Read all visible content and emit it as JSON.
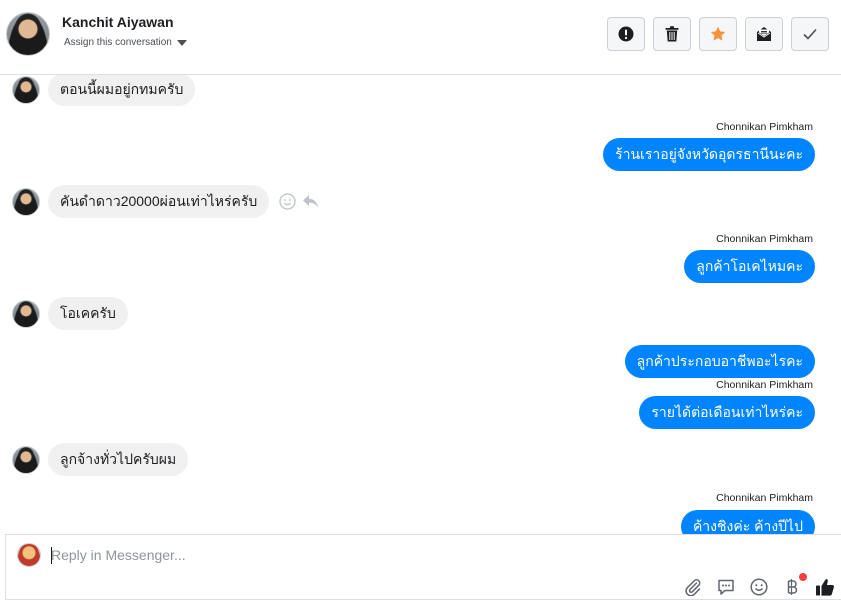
{
  "header": {
    "contact_name": "Kanchit Aiyawan",
    "assign_label": "Assign this conversation",
    "toolbar": [
      {
        "name": "mark-spam-button",
        "icon": "exclamation-circle-icon"
      },
      {
        "name": "delete-button",
        "icon": "trash-icon"
      },
      {
        "name": "star-button",
        "icon": "star-icon",
        "color": "#f7923b"
      },
      {
        "name": "mark-unread-button",
        "icon": "envelope-icon"
      },
      {
        "name": "mark-done-button",
        "icon": "check-icon"
      }
    ]
  },
  "messages": [
    {
      "direction": "in",
      "text": "ตอนนี้ผมอยู่กทมครับ"
    },
    {
      "direction": "out",
      "sender": "Chonnikan Pimkham",
      "text": "ร้านเราอยู่จังหวัดอุดรธานีนะคะ"
    },
    {
      "direction": "in",
      "text": "คันดำดาว20000ผ่อนเท่าไหร่ครับ"
    },
    {
      "direction": "out",
      "sender": "Chonnikan Pimkham",
      "text": "ลูกค้าโอเคไหมคะ"
    },
    {
      "direction": "in",
      "text": "โอเคครับ"
    },
    {
      "direction": "out",
      "text": "ลูกค้าประกอบอาชีพอะไรคะ"
    },
    {
      "direction": "out",
      "sender": "Chonnikan Pimkham",
      "text": "รายได้ต่อเดือนเท่าไหร่คะ"
    },
    {
      "direction": "in",
      "text": "ลูกจ้างทั่วไปครับผม"
    },
    {
      "direction": "out",
      "sender": "Chonnikan Pimkham",
      "text": "ค้างชิงค่ะ ค้างปีไป"
    }
  ],
  "composer": {
    "placeholder": "Reply in Messenger...",
    "tools": [
      "paperclip-icon",
      "saved-reply-icon",
      "emoji-icon",
      "baht-payment-icon",
      "thumbs-up-icon"
    ]
  },
  "colors": {
    "outgoing_bubble": "#0084ff",
    "incoming_bubble": "#f1f0f0",
    "star": "#f7923b"
  }
}
